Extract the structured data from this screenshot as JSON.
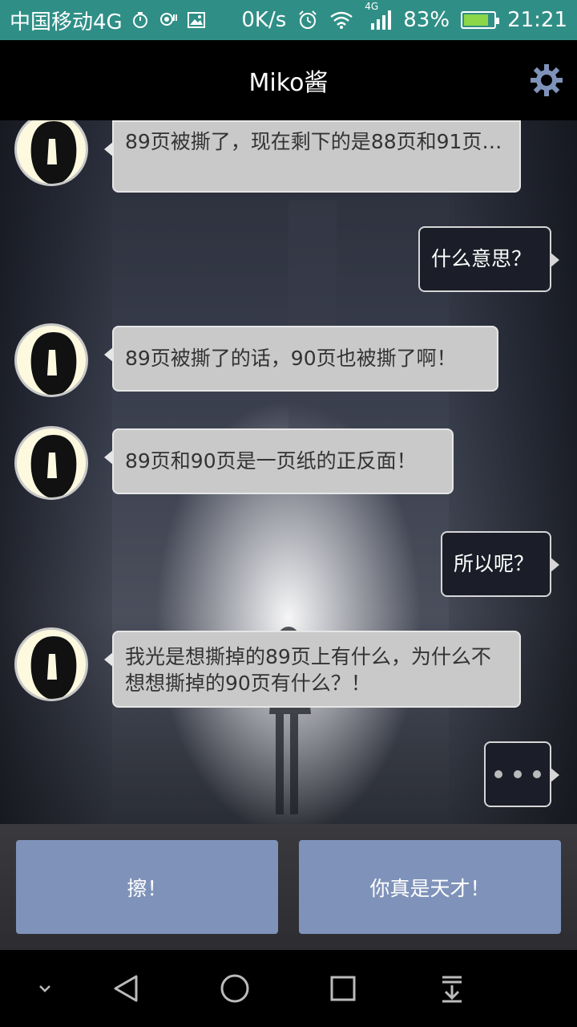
{
  "status_bar": {
    "carrier": "中国移动4G",
    "speed": "0K/s",
    "network": "4G",
    "battery": "83%",
    "battery_level": 0.83,
    "time": "21:21"
  },
  "header": {
    "title": "Miko酱",
    "settings_icon": "gear-icon"
  },
  "messages": [
    {
      "from": "miko",
      "text": "89页被撕了，现在剩下的是88页和91页…"
    },
    {
      "from": "me",
      "text": "什么意思？"
    },
    {
      "from": "miko",
      "text": "89页被撕了的话，90页也被撕了啊！"
    },
    {
      "from": "miko",
      "text": "89页和90页是一页纸的正反面！"
    },
    {
      "from": "me",
      "text": "所以呢？"
    },
    {
      "from": "miko",
      "text": "我光是想撕掉的89页上有什么，为什么不想想撕掉的90页有什么？！"
    },
    {
      "from": "me",
      "typing": true
    }
  ],
  "replies": [
    {
      "label": "擦！"
    },
    {
      "label": "你真是天才！"
    }
  ],
  "colors": {
    "status_bar": "#2f8f86",
    "reply_button": "#7f93ba",
    "left_bubble": "#c9c9c9",
    "right_bubble": "#1b1e28"
  }
}
